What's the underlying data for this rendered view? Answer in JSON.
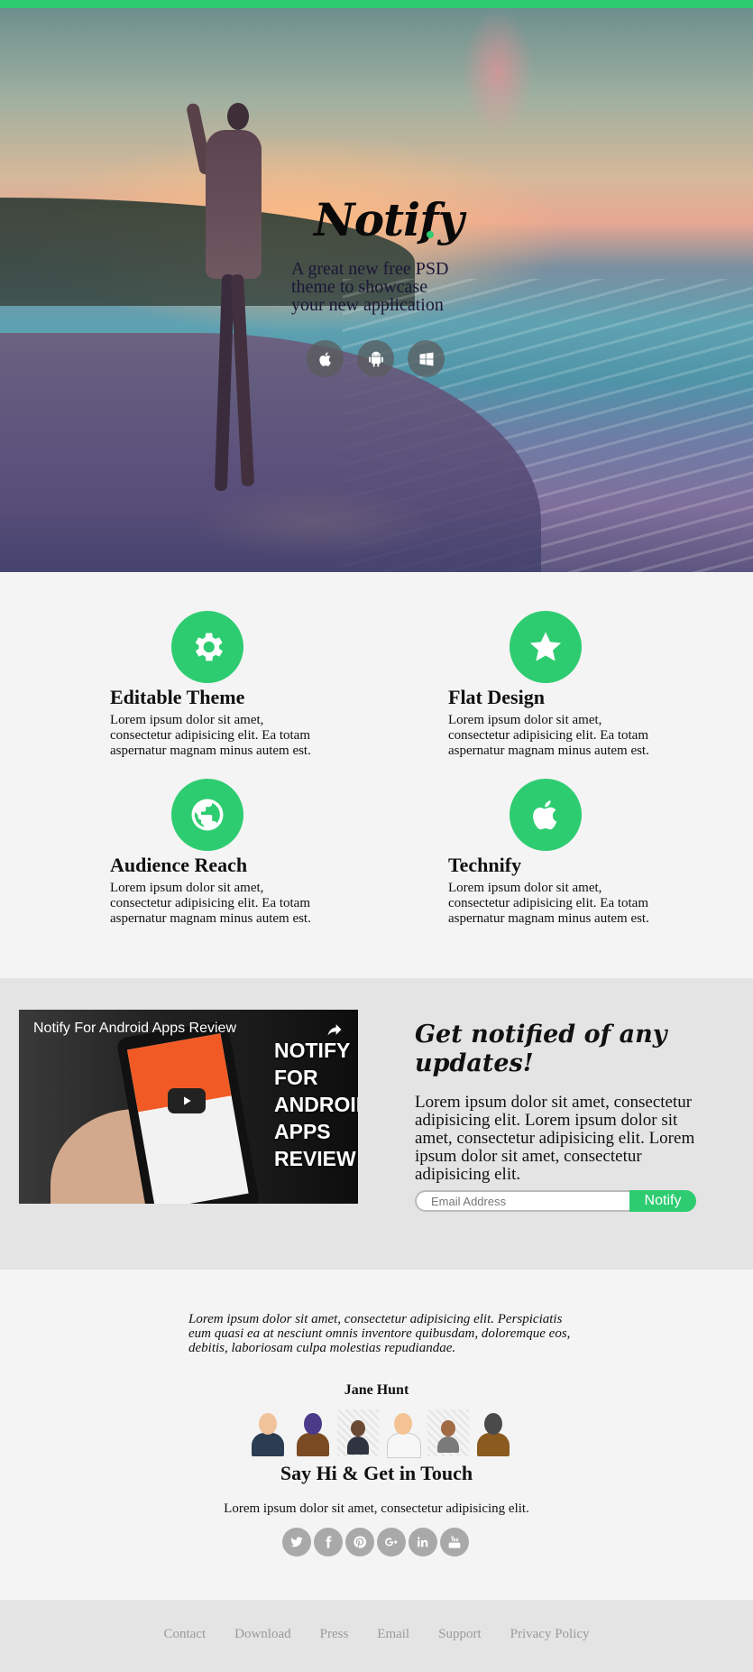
{
  "hero": {
    "logo": "Notify",
    "tagline": "A great new free PSD theme to showcase your new application",
    "platforms": [
      {
        "icon": "apple-icon"
      },
      {
        "icon": "android-icon"
      },
      {
        "icon": "windows-icon"
      }
    ]
  },
  "features": [
    {
      "icon": "gear-icon",
      "title": "Editable Theme",
      "text": "Lorem ipsum dolor sit amet, consectetur adipisicing elit. Ea totam aspernatur magnam minus autem est."
    },
    {
      "icon": "star-icon",
      "title": "Flat Design",
      "text": "Lorem ipsum dolor sit amet, consectetur adipisicing elit. Ea totam aspernatur magnam minus autem est."
    },
    {
      "icon": "globe-icon",
      "title": "Audience Reach",
      "text": "Lorem ipsum dolor sit amet, consectetur adipisicing elit. Ea totam aspernatur magnam minus autem est."
    },
    {
      "icon": "apple-icon",
      "title": "Technify",
      "text": "Lorem ipsum dolor sit amet, consectetur adipisicing elit. Ea totam aspernatur magnam minus autem est."
    }
  ],
  "video": {
    "title": "Notify For Android Apps Review",
    "overlay_text": "NOTIFY FOR ANDROID APPS REVIEW"
  },
  "newsletter": {
    "title": "Get notified of any updates!",
    "text": "Lorem ipsum dolor sit amet, consectetur adipisicing elit. Lorem ipsum dolor sit amet, consectetur adipisicing elit. Lorem ipsum dolor sit amet, consectetur adipisicing elit.",
    "email_placeholder": "Email Address",
    "button_label": "Notify"
  },
  "testimonial": {
    "quote": "Lorem ipsum dolor sit amet, consectetur adipisicing elit. Perspiciatis eum quasi ea at nesciunt omnis inventore quibusdam, doloremque eos, debitis, laboriosam culpa molestias repudiandae.",
    "name": "Jane Hunt",
    "avatars": [
      "avatar-businessman",
      "avatar-woman",
      "avatar-man-suit",
      "avatar-doctor",
      "avatar-man-laptop",
      "avatar-man-brown"
    ]
  },
  "contact": {
    "title": "Say Hi & Get in Touch",
    "text": "Lorem ipsum dolor sit amet, consectetur adipisicing elit.",
    "socials": [
      "twitter-icon",
      "facebook-icon",
      "pinterest-icon",
      "google-plus-icon",
      "linkedin-icon",
      "youtube-icon"
    ]
  },
  "footer": {
    "links": [
      "Contact",
      "Download",
      "Press",
      "Email",
      "Support",
      "Privacy Policy"
    ]
  },
  "colors": {
    "accent": "#2ecc71",
    "footer_bg": "#e4e4e4",
    "section_bg": "#f4f4f4"
  }
}
